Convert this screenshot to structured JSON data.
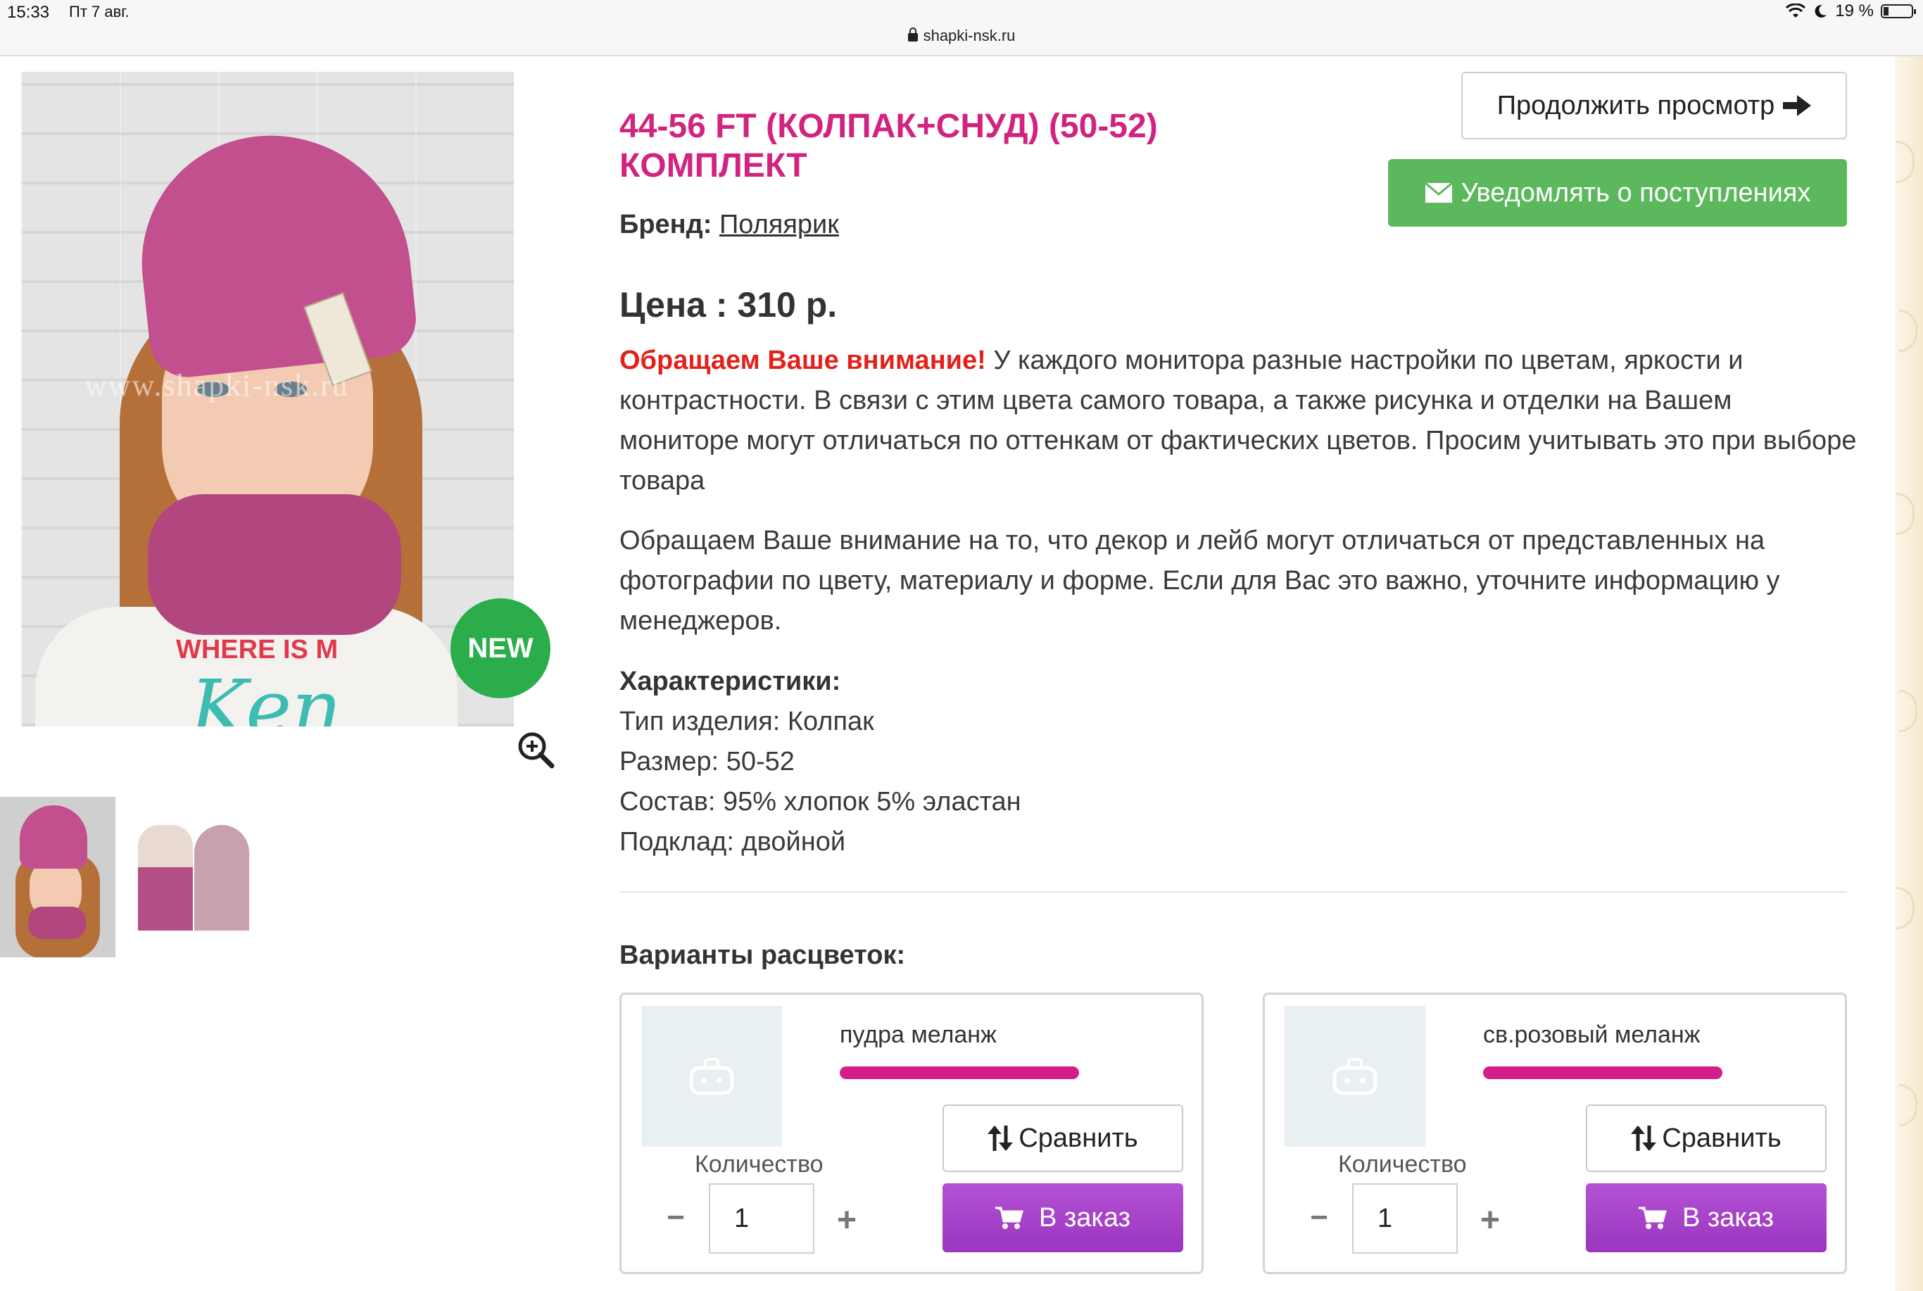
{
  "status_bar": {
    "time": "15:33",
    "date": "Пт 7 авг.",
    "battery": "19 %",
    "battery_level": 0.19,
    "url": "shapki-nsk.ru"
  },
  "gallery": {
    "badge": "NEW",
    "watermark": "www.shapki-nsk.ru",
    "shirt_text": "WHERE IS M",
    "shirt_script": "Ken"
  },
  "product": {
    "title": "44-56 FT (КОЛПАК+СНУД) (50-52) КОМПЛЕКТ",
    "brand_label": "Бренд:",
    "brand_value": "Поляярик",
    "price": "Цена : 310 р.",
    "warning_label": "Обращаем Ваше внимание!",
    "warning_text": " У каждого монитора разные настройки по цветам, яркости и контрастности. В связи с этим цвета самого товара, а также рисунка и отделки на Вашем мониторе могут отличаться по оттенкам от фактических цветов. Просим учитывать это при выборе товара",
    "note": "Обращаем Ваше внимание на то, что декор и лейб могут отличаться от представленных на фотографии по цвету, материалу и форме. Если для Вас это важно, уточните информацию у менеджеров.",
    "characteristics_title": "Характеристики:",
    "characteristics": [
      "Тип изделия: Колпак",
      "Размер: 50-52",
      "Состав: 95% хлопок 5% эластан",
      "Подклад: двойной"
    ]
  },
  "actions": {
    "continue_label": "Продолжить просмотр",
    "notify_label": "Уведомлять о поступлениях"
  },
  "variants": {
    "title": "Варианты расцветок:",
    "items": [
      {
        "name": "пудра меланж",
        "compare_label": "Сравнить",
        "qty_label": "Количество",
        "qty_value": "1",
        "order_label": "В заказ"
      },
      {
        "name": "св.розовый меланж",
        "compare_label": "Сравнить",
        "qty_label": "Количество",
        "qty_value": "1",
        "order_label": "В заказ"
      }
    ]
  },
  "colors": {
    "title": "#d1237f",
    "warning": "#e3211a",
    "notify_button": "#5cb85c",
    "order_button": "#a63fc9",
    "variant_bar": "#d41f8a",
    "new_badge": "#2aad4a"
  }
}
